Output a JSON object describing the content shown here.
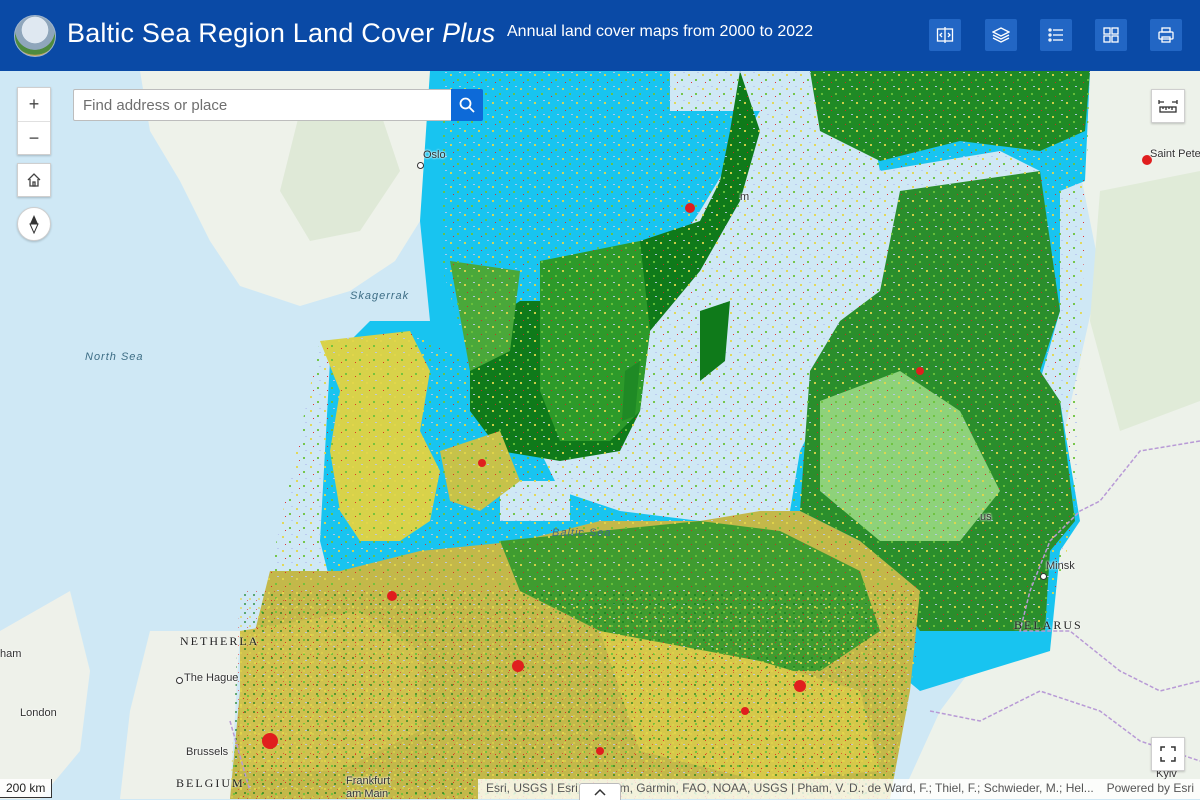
{
  "header": {
    "title_main": "Baltic Sea Region Land Cover ",
    "title_italic": "Plus",
    "subtitle": "Annual land cover maps from 2000 to 2022",
    "background_color": "#0a4aa6",
    "buttons": [
      {
        "name": "swipe-compare-icon"
      },
      {
        "name": "layers-icon"
      },
      {
        "name": "legend-list-icon"
      },
      {
        "name": "basemap-gallery-icon"
      },
      {
        "name": "print-icon"
      }
    ]
  },
  "search": {
    "placeholder": "Find address or place"
  },
  "controls": {
    "zoom_in": "+",
    "zoom_out": "−",
    "home_icon": "home-icon",
    "compass_icon": "compass-icon",
    "measure_icon": "measure-icon",
    "fullscreen_icon": "fullscreen-icon"
  },
  "map": {
    "places": [
      "Oslo",
      "Saint Pete",
      "Minsk",
      "The Hague",
      "London",
      "Brussels",
      "Frankfurt",
      "am Main",
      "Kyiv",
      "ham",
      "us",
      "m"
    ],
    "countries": [
      "NETHERLA",
      "BELARUS",
      "BELGIUM"
    ],
    "water_labels": [
      "Skagerrak",
      "North Sea",
      "Baltic Sea"
    ],
    "land_cover_colors": {
      "forest": "#0f7a1a",
      "grassland": "#6cc23a",
      "cropland": "#e3d64a",
      "urban": "#e01e1e",
      "water": "#18c4f0",
      "wetland": "#b9c7ee"
    }
  },
  "scalebar": "200 km",
  "attribution": {
    "text": "Esri, USGS | Esri, TomTom, Garmin, FAO, NOAA, USGS | Pham, V. D.; de Ward, F.; Thiel, F.; Schwieder, M.; Hel...",
    "powered": "Powered by Esri"
  }
}
